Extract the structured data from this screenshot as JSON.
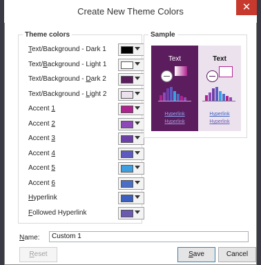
{
  "window": {
    "title": "Create New Theme Colors",
    "help_label": "?",
    "close_label": "✕"
  },
  "theme_colors": {
    "group_title": "Theme colors",
    "items": [
      {
        "label": "Text/Background - Dark 1",
        "accel": "T",
        "color": "#000000"
      },
      {
        "label": "Text/Background - Light 1",
        "accel": "B",
        "color": "#ffffff"
      },
      {
        "label": "Text/Background - Dark 2",
        "accel": "D",
        "color": "#5c1d5e"
      },
      {
        "label": "Text/Background - Light 2",
        "accel": "L",
        "color": "#ebe2ee"
      },
      {
        "label": "Accent 1",
        "accel": "1",
        "color": "#b0238f"
      },
      {
        "label": "Accent 2",
        "accel": "2",
        "color": "#8e49b8"
      },
      {
        "label": "Accent 3",
        "accel": "3",
        "color": "#6d3fa8"
      },
      {
        "label": "Accent 4",
        "accel": "4",
        "color": "#5b5bc2"
      },
      {
        "label": "Accent 5",
        "accel": "5",
        "color": "#3d9ee0"
      },
      {
        "label": "Accent 6",
        "accel": "6",
        "color": "#4a6dc8"
      },
      {
        "label": "Hyperlink",
        "accel": "H",
        "color": "#3b5fc0"
      },
      {
        "label": "Followed Hyperlink",
        "accel": "F",
        "color": "#6a5ab0"
      }
    ]
  },
  "sample": {
    "group_title": "Sample",
    "dark_panel": {
      "text": "Text",
      "link": "Hyperlink",
      "followed_link": "Hyperlink"
    },
    "light_panel": {
      "text": "Text",
      "link": "Hyperlink",
      "followed_link": "Hyperlink"
    }
  },
  "name_field": {
    "label": "Name:",
    "value": "Custom 1"
  },
  "buttons": {
    "reset": "Reset",
    "save": "Save",
    "cancel": "Cancel"
  }
}
